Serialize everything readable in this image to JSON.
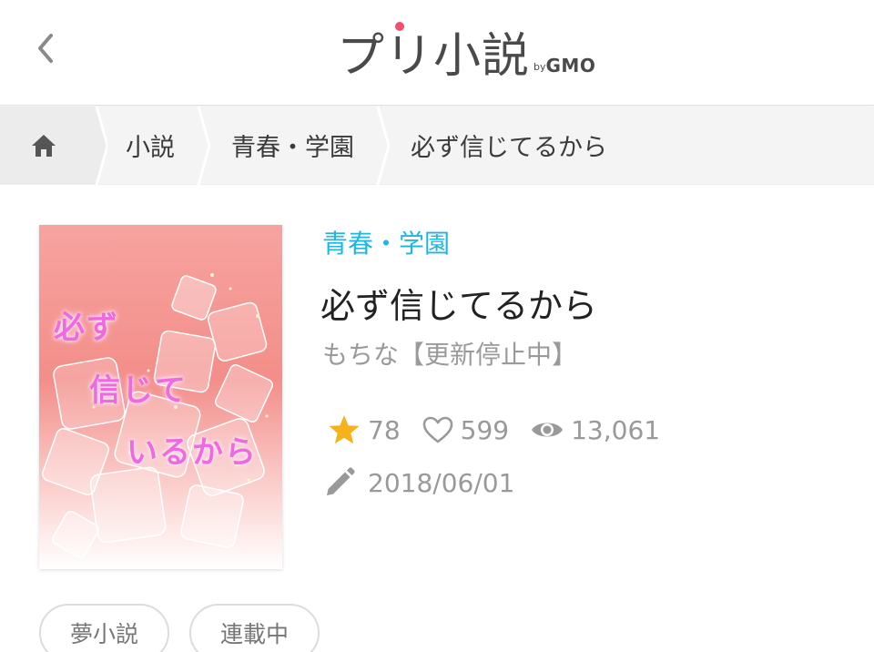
{
  "header": {
    "logo_main": "プリ小説",
    "logo_by": "by",
    "logo_gmo": "GMO"
  },
  "breadcrumb": {
    "items": [
      "小説",
      "青春・学園",
      "必ず信じてるから"
    ]
  },
  "book": {
    "cover_text": [
      "必ず",
      "信じて",
      "いるから"
    ],
    "category": "青春・学園",
    "title": "必ず信じてるから",
    "author": "もちな【更新停止中】",
    "stats": {
      "stars": "78",
      "likes": "599",
      "views": "13,061"
    },
    "updated": "2018/06/01",
    "tags": [
      "夢小説",
      "連載中"
    ]
  },
  "colors": {
    "accent": "#1fb6df",
    "star": "#f5b21b",
    "logo_dot": "#f0506e"
  },
  "icons": [
    "back-chevron-icon",
    "home-icon",
    "star-icon",
    "heart-icon",
    "eye-icon",
    "pencil-icon"
  ]
}
